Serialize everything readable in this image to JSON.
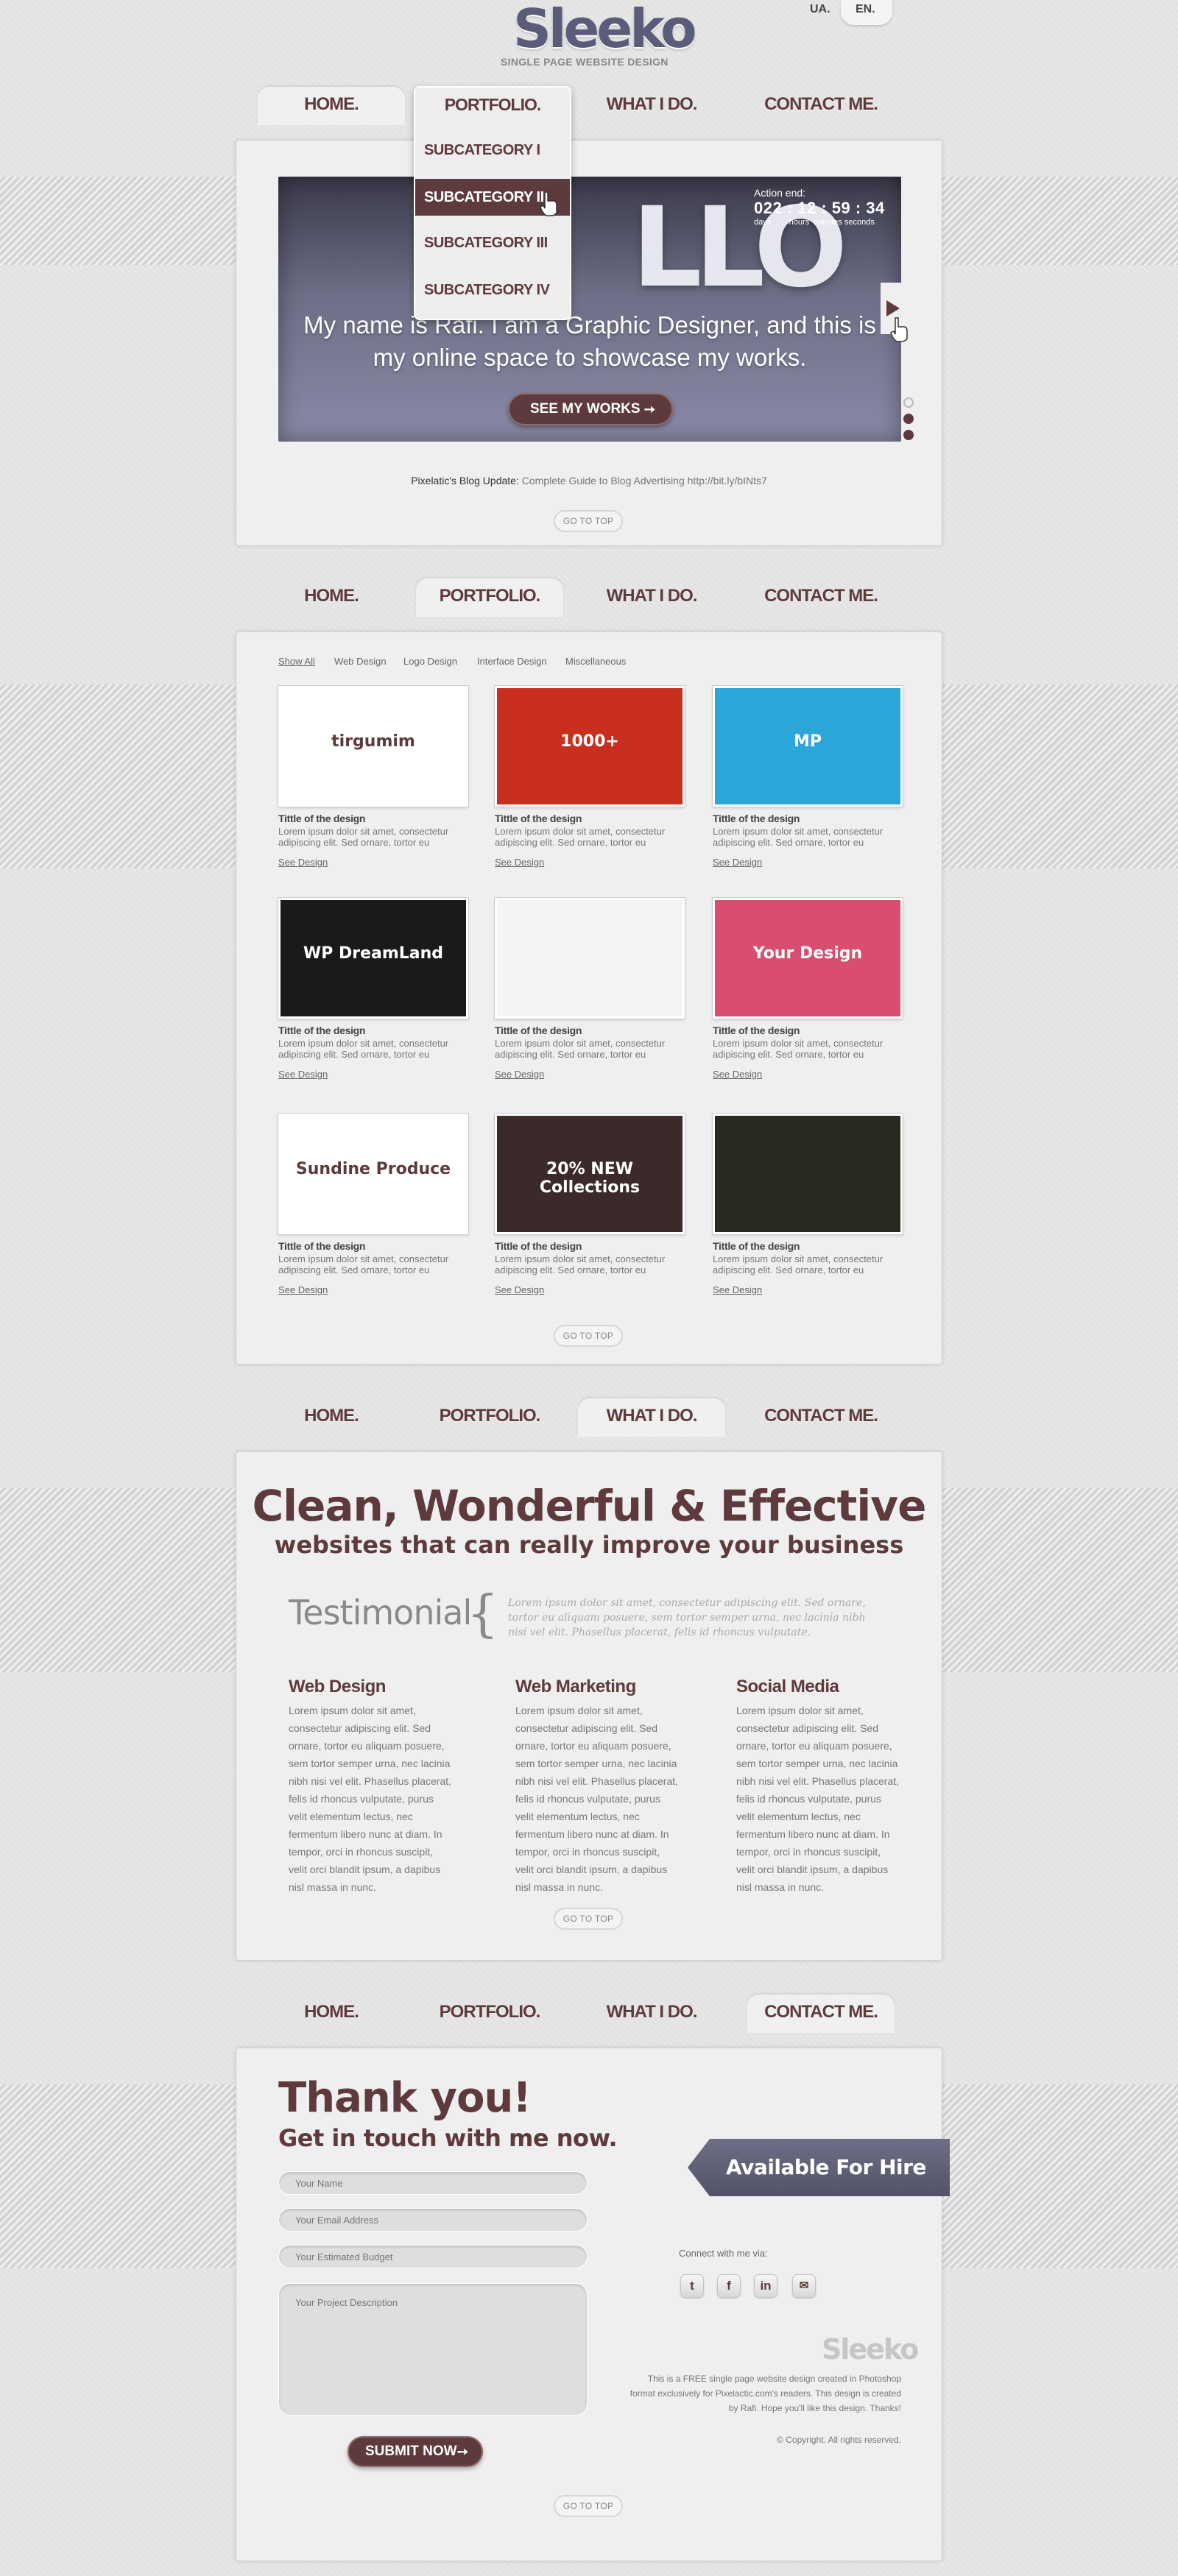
{
  "header": {
    "logo": "Sleeko",
    "tagline": "SINGLE PAGE WEBSITE DESIGN",
    "languages": [
      "UA.",
      "EN."
    ]
  },
  "nav": {
    "items": [
      "HOME.",
      "PORTFOLIO.",
      "WHAT I DO.",
      "CONTACT ME."
    ]
  },
  "dropdown": {
    "items": [
      "SUBCATEGORY I",
      "SUBCATEGORY II",
      "SUBCATEGORY III",
      "SUBCATEGORY IV"
    ],
    "selected_index": 1
  },
  "slider": {
    "big_text": "LLO",
    "text": "My name is Rafi. I am a Graphic Designer, and this is my online space to showcase my works.",
    "button": "SEE MY WORKS",
    "action_label": "Action end:",
    "countdown": "022 : 12 : 59 : 34",
    "countdown_units": "days        hours  minutes seconds"
  },
  "blog": {
    "label": "Pixelatic's Blog Update:",
    "text": "Complete Guide to Blog Advertising http://bit.ly/bINts7"
  },
  "go_to_top": "GO TO TOP",
  "portfolio": {
    "filters": [
      "Show All",
      "Web Design",
      "Logo Design",
      "Interface Design",
      "Miscellaneous"
    ],
    "item_title": "Tittle of the design",
    "item_desc": "Lorem ipsum dolor sit amet, consectetur adipiscing elit. Sed ornare, tortor eu",
    "item_link": "See Design",
    "thumbs": [
      {
        "label": "tirgumim",
        "color": "#ffffff"
      },
      {
        "label": "1000+",
        "color": "#c92f1e"
      },
      {
        "label": "MP",
        "color": "#2aa6d8"
      },
      {
        "label": "WP DreamLand",
        "color": "#1a1a1a"
      },
      {
        "label": "",
        "color": "#f4f4f4"
      },
      {
        "label": "Your Design",
        "color": "#d94e6e"
      },
      {
        "label": "Sundine Produce",
        "color": "#ffffff"
      },
      {
        "label": "20% NEW Collections",
        "color": "#3a2a2a"
      },
      {
        "label": "",
        "color": "#2a2a22"
      }
    ]
  },
  "whatido": {
    "headline1": "Clean, Wonderful & Effective",
    "headline2": "websites that can really improve your business",
    "testimonial_label": "Testimonial",
    "testimonial_text": "Lorem ipsum dolor sit amet, consectetur adipiscing elit. Sed ornare, tortor eu aliquam posuere, sem tortor semper urna, nec lacinia nibh nisi vel elit. Phasellus placerat, felis id rhoncus vulputate.",
    "services": [
      {
        "title": "Web Design",
        "text": "Lorem ipsum dolor sit amet, consectetur adipiscing elit. Sed ornare, tortor eu aliquam posuere, sem tortor semper urna, nec lacinia nibh nisi vel elit. Phasellus placerat, felis id rhoncus vulputate, purus velit elementum lectus, nec fermentum libero nunc at diam. In tempor, orci in rhoncus suscipit, velit orci blandit ipsum, a dapibus nisl massa in nunc."
      },
      {
        "title": "Web Marketing",
        "text": "Lorem ipsum dolor sit amet, consectetur adipiscing elit. Sed ornare, tortor eu aliquam posuere, sem tortor semper urna, nec lacinia nibh nisi vel elit. Phasellus placerat, felis id rhoncus vulputate, purus velit elementum lectus, nec fermentum libero nunc at diam. In tempor, orci in rhoncus suscipit, velit orci blandit ipsum, a dapibus nisl massa in nunc."
      },
      {
        "title": "Social Media",
        "text": "Lorem ipsum dolor sit amet, consectetur adipiscing elit. Sed ornare, tortor eu aliquam posuere, sem tortor semper urna, nec lacinia nibh nisi vel elit. Phasellus placerat, felis id rhoncus vulputate, purus velit elementum lectus, nec fermentum libero nunc at diam. In tempor, orci in rhoncus suscipit, velit orci blandit ipsum, a dapibus nisl massa in nunc."
      }
    ]
  },
  "contact": {
    "thanks": "Thank you!",
    "touch": "Get in touch with me now.",
    "placeholders": {
      "name": "Your Name",
      "email": "Your Email Address",
      "budget": "Your Estimated Budget",
      "description": "Your Project Description"
    },
    "submit": "SUBMIT NOW",
    "hire": "Available For Hire",
    "connect": "Connect with me via:",
    "footer_logo": "Sleeko",
    "footer_text": "This is a FREE single page website design created in Photoshop format exclusively for Pixelactic.com's readers. This design is created by Rafi. Hope you'll like this design. Thanks!",
    "copyright": "© Copyright. All rights reserved."
  },
  "colors": {
    "accent": "#5e3a3c",
    "slider": "#6e6e86"
  }
}
